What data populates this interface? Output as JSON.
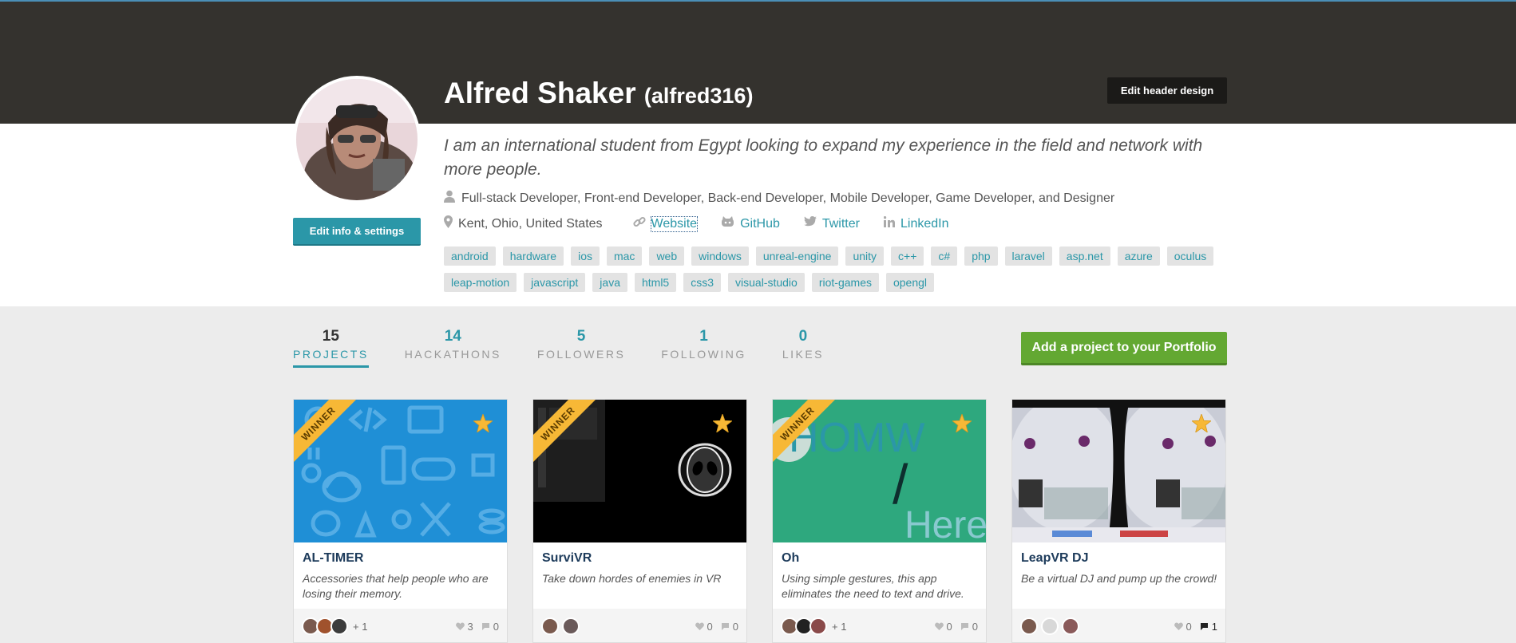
{
  "profile": {
    "name": "Alfred Shaker",
    "username": "(alfred316)",
    "bio": "I am an international student from Egypt looking to expand my experience in the field and network with more people.",
    "roles": "Full-stack Developer, Front-end Developer, Back-end Developer, Mobile Developer, Game Developer, and Designer",
    "location": "Kent, Ohio, United States",
    "links": {
      "website": "Website",
      "github": "GitHub",
      "twitter": "Twitter",
      "linkedin": "LinkedIn"
    },
    "edit_info_label": "Edit info & settings",
    "edit_header_label": "Edit header design"
  },
  "tags": [
    "android",
    "hardware",
    "ios",
    "mac",
    "web",
    "windows",
    "unreal-engine",
    "unity",
    "c++",
    "c#",
    "php",
    "laravel",
    "asp.net",
    "azure",
    "oculus",
    "leap-motion",
    "javascript",
    "java",
    "html5",
    "css3",
    "visual-studio",
    "riot-games",
    "opengl"
  ],
  "stats": [
    {
      "num": "15",
      "label": "PROJECTS",
      "active": true
    },
    {
      "num": "14",
      "label": "HACKATHONS",
      "active": false
    },
    {
      "num": "5",
      "label": "FOLLOWERS",
      "active": false
    },
    {
      "num": "1",
      "label": "FOLLOWING",
      "active": false
    },
    {
      "num": "0",
      "label": "LIKES",
      "active": false
    }
  ],
  "add_project_label": "Add a project to your Portfolio",
  "projects": [
    {
      "title": "AL-TIMER",
      "desc": "Accessories that help people who are losing their memory.",
      "winner": "WINNER",
      "more": "+ 1",
      "likes": "3",
      "comments": "0"
    },
    {
      "title": "SurviVR",
      "desc": "Take down hordes of enemies in VR",
      "winner": "WINNER",
      "more": "",
      "likes": "0",
      "comments": "0"
    },
    {
      "title": "Oh",
      "desc": "Using simple gestures, this app eliminates the need to text and drive.",
      "winner": "WINNER",
      "more": "+ 1",
      "likes": "0",
      "comments": "0",
      "thumb_text_1": "HOMW",
      "thumb_text_2": "/",
      "thumb_text_3": "Here"
    },
    {
      "title": "LeapVR DJ",
      "desc": "Be a virtual DJ and pump up the crowd!",
      "winner": "",
      "more": "",
      "likes": "0",
      "comments": "1"
    }
  ],
  "colors": {
    "accent": "#2b97a8",
    "header": "#34322e",
    "add_button": "#63a832",
    "winner": "#f7b836",
    "star": "#f7b836"
  }
}
